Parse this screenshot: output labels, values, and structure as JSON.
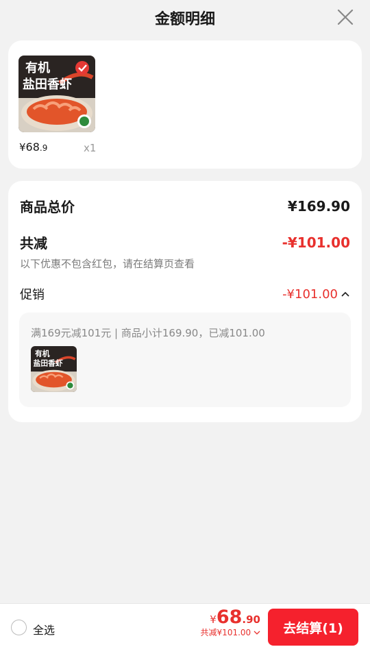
{
  "header": {
    "title": "金额明细"
  },
  "product": {
    "image_text_line1": "有机",
    "image_text_line2": "盐田香虾",
    "price_currency": "¥",
    "price_int": "68",
    "price_dec": ".9",
    "qty": "x1"
  },
  "summary": {
    "total_label": "商品总价",
    "total_value": "¥169.90",
    "discount_label": "共减",
    "discount_value": "-¥101.00",
    "note": "以下优惠不包含红包，请在结算页查看",
    "promo_label": "促销",
    "promo_value": "-¥101.00",
    "promo_detail": "满169元减101元 | 商品小计169.90，已减101.00"
  },
  "bottom": {
    "select_all": "全选",
    "total_currency": "¥",
    "total_int": "68",
    "total_dec": ".90",
    "saved": "共减¥101.00",
    "checkout": "去结算(1)"
  },
  "colors": {
    "accent": "#e8302d",
    "button": "#f5212d"
  }
}
